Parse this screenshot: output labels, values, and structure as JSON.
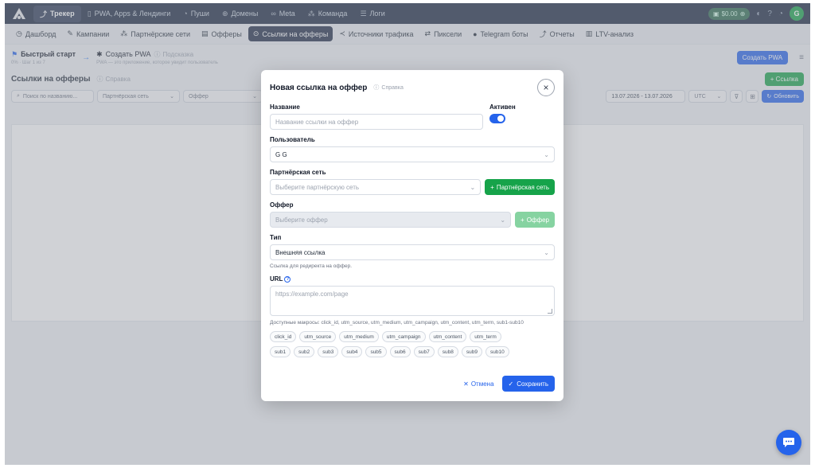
{
  "topbar": {
    "items": [
      {
        "label": "Трекер",
        "icon": "chart-icon",
        "active": true
      },
      {
        "label": "PWA, Apps & Лендинги",
        "icon": "phone-icon"
      },
      {
        "label": "Пуши",
        "icon": "bell-icon"
      },
      {
        "label": "Домены",
        "icon": "globe-icon"
      },
      {
        "label": "Meta",
        "icon": "meta-icon"
      },
      {
        "label": "Команда",
        "icon": "team-icon"
      },
      {
        "label": "Логи",
        "icon": "list-icon"
      }
    ],
    "balance": "$0.00",
    "avatar_letter": "G"
  },
  "subnav": {
    "items": [
      {
        "label": "Дашборд"
      },
      {
        "label": "Кампании"
      },
      {
        "label": "Партнёрские сети"
      },
      {
        "label": "Офферы"
      },
      {
        "label": "Ссылки на офферы",
        "active": true
      },
      {
        "label": "Источники трафика"
      },
      {
        "label": "Пиксели"
      },
      {
        "label": "Telegram боты"
      },
      {
        "label": "Отчеты"
      },
      {
        "label": "LTV-анализ"
      }
    ]
  },
  "quickstart": {
    "title": "Быстрый старт",
    "progress": "0% · Шаг 1 из 7",
    "step_title": "Создать PWA",
    "step_desc": "PWA — это приложение, которое увидит пользователь",
    "help": "Подсказка",
    "create_pwa": "Создать PWA"
  },
  "page": {
    "title": "Ссылки на офферы",
    "help": "Справка",
    "add_button": "Ссылка"
  },
  "filters": {
    "search_placeholder": "Поиск по названию...",
    "network": "Партнёрская сеть",
    "offer": "Оффер",
    "date_range": "13.07.2026 - 13.07.2026",
    "timezone": "UTC",
    "refresh": "Обновить"
  },
  "modal": {
    "title": "Новая ссылка на оффер",
    "help": "Справка",
    "name_label": "Название",
    "name_placeholder": "Название ссылки на оффер",
    "active_label": "Активен",
    "active": true,
    "user_label": "Пользователь",
    "user_value": "G G",
    "network_label": "Партнёрская сеть",
    "network_placeholder": "Выберите партнёрскую сеть",
    "network_add": "Партнёрская сеть",
    "offer_label": "Оффер",
    "offer_placeholder": "Выберите оффер",
    "offer_add": "Оффер",
    "type_label": "Тип",
    "type_value": "Внешняя ссылка",
    "type_hint": "Ссылка для редиректа на оффер.",
    "url_label": "URL",
    "url_placeholder": "https://example.com/page",
    "macros_text": "Доступные макросы: click_id, utm_source, utm_medium, utm_campaign, utm_content, utm_term, sub1-sub10",
    "macros_row1": [
      "click_id",
      "utm_source",
      "utm_medium",
      "utm_campaign",
      "utm_content",
      "utm_term"
    ],
    "macros_row2": [
      "sub1",
      "sub2",
      "sub3",
      "sub4",
      "sub5",
      "sub6",
      "sub7",
      "sub8",
      "sub9",
      "sub10"
    ],
    "cancel": "Отмена",
    "save": "Сохранить"
  },
  "colors": {
    "primary": "#2563eb",
    "success": "#16a34a",
    "nav_bg": "#1b2740"
  }
}
